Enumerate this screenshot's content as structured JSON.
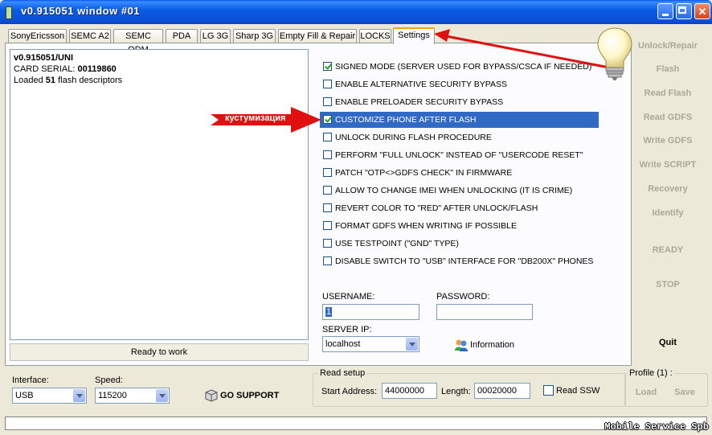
{
  "window": {
    "title": "v0.915051 window #01"
  },
  "tabs": [
    "SonyEricsson",
    "SEMC A2",
    "SEMC ODM",
    "PDA",
    "LG 3G",
    "Sharp 3G",
    "Empty Fill & Repair",
    "LOCKS",
    "Settings"
  ],
  "active_tab": "Settings",
  "log": {
    "version": "v0.915051/UNI",
    "serial_label": "CARD SERIAL: ",
    "serial_value": "00119860",
    "loaded_prefix": "Loaded ",
    "loaded_count": "51",
    "loaded_suffix": " flash descriptors"
  },
  "status_text": "Ready to work",
  "settings": [
    {
      "label": "SIGNED MODE (SERVER USED FOR BYPASS/CSCA IF NEEDED)",
      "checked": true
    },
    {
      "label": "ENABLE ALTERNATIVE SECURITY BYPASS",
      "checked": false
    },
    {
      "label": "ENABLE PRELOADER SECURITY BYPASS",
      "checked": false
    },
    {
      "label": "CUSTOMIZE PHONE AFTER FLASH",
      "checked": true,
      "highlighted": true
    },
    {
      "label": "UNLOCK DURING FLASH PROCEDURE",
      "checked": false
    },
    {
      "label": "PERFORM \"FULL UNLOCK\" INSTEAD OF \"USERCODE RESET\"",
      "checked": false
    },
    {
      "label": "PATCH \"OTP<>GDFS CHECK\" IN FIRMWARE",
      "checked": false
    },
    {
      "label": "ALLOW TO CHANGE IMEI WHEN UNLOCKING (IT IS CRIME)",
      "checked": false
    },
    {
      "label": "REVERT COLOR TO \"RED\" AFTER UNLOCK/FLASH",
      "checked": false
    },
    {
      "label": "FORMAT GDFS WHEN WRITING IF POSSIBLE",
      "checked": false
    },
    {
      "label": "USE TESTPOINT (\"GND\" TYPE)",
      "checked": false
    },
    {
      "label": "DISABLE SWITCH TO \"USB\" INTERFACE FOR \"DB200X\" PHONES",
      "checked": false
    }
  ],
  "credentials": {
    "username_label": "USERNAME:",
    "username_value": "1",
    "password_label": "PASSWORD:",
    "password_value": "",
    "server_label": "SERVER IP:",
    "server_value": "localhost",
    "information_label": "Information"
  },
  "side_buttons": [
    {
      "label": "Unlock/Repair",
      "enabled": false
    },
    {
      "label": "Flash",
      "enabled": false
    },
    {
      "label": "Read Flash",
      "enabled": false
    },
    {
      "label": "Read GDFS",
      "enabled": false
    },
    {
      "label": "Write GDFS",
      "enabled": false
    },
    {
      "label": "Write SCRIPT",
      "enabled": false
    },
    {
      "label": "Recovery",
      "enabled": false
    },
    {
      "label": "Identify",
      "enabled": false
    },
    {
      "label": "READY",
      "enabled": false
    },
    {
      "label": "STOP",
      "enabled": false
    },
    {
      "label": "Quit",
      "enabled": true
    }
  ],
  "bottom": {
    "interface_label": "Interface:",
    "interface_value": "USB",
    "speed_label": "Speed:",
    "speed_value": "115200",
    "go_support": "GO SUPPORT",
    "read_setup_title": "Read setup",
    "start_label": "Start Address:",
    "start_value": "44000000",
    "length_label": "Length:",
    "length_value": "00020000",
    "read_ssw": "Read SSW",
    "profile_title": "Profile (1) :",
    "load": "Load",
    "save": "Save"
  },
  "annotation": {
    "arrow_text": "кустумизация"
  },
  "watermark": "Mobile Service Spb",
  "colors": {
    "title_blue": "#0a5ce4",
    "highlight": "#316ac5",
    "arrow_red": "#e01010",
    "tab_accent": "#f6a400"
  }
}
